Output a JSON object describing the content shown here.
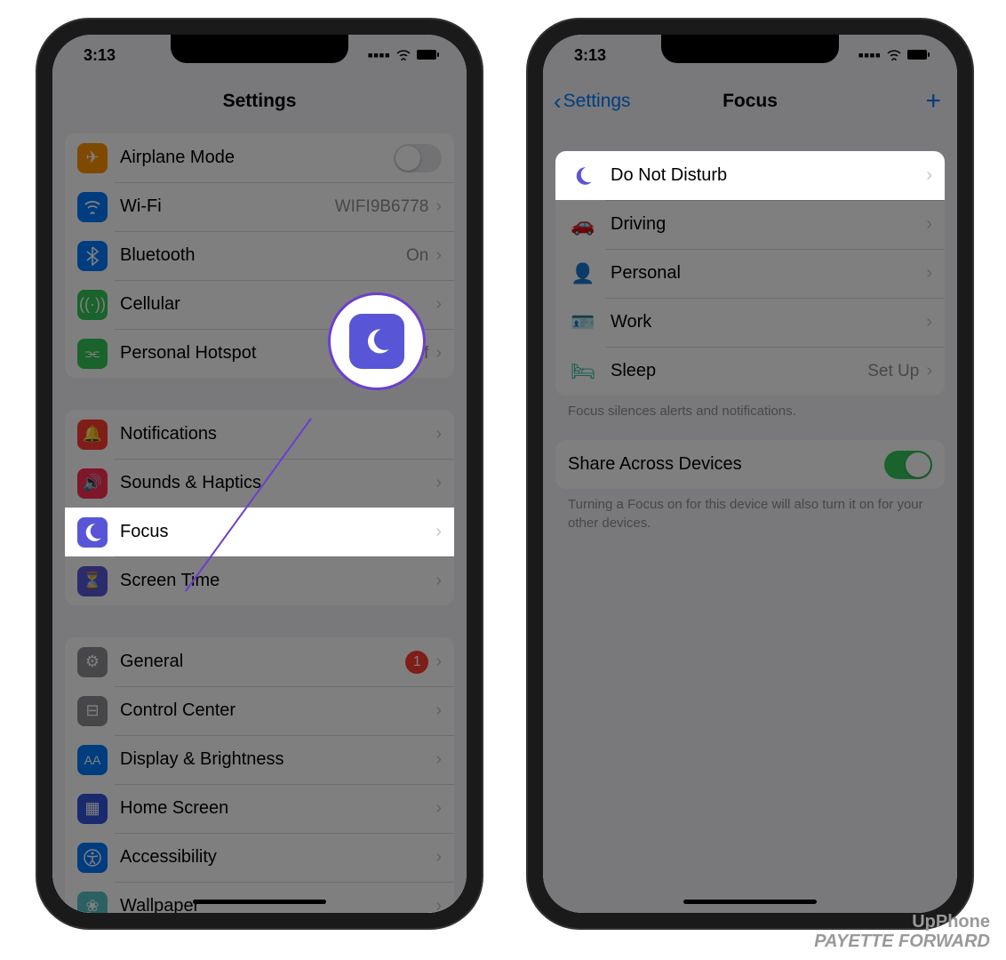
{
  "status": {
    "time": "3:13"
  },
  "left": {
    "title": "Settings",
    "groups": [
      [
        {
          "icon": "airplane-icon",
          "color": "#ff9500",
          "label": "Airplane Mode",
          "toggle": false
        },
        {
          "icon": "wifi-icon",
          "color": "#007aff",
          "label": "Wi-Fi",
          "value": "WIFI9B6778"
        },
        {
          "icon": "bluetooth-icon",
          "color": "#007aff",
          "label": "Bluetooth",
          "value": "On"
        },
        {
          "icon": "cellular-icon",
          "color": "#34c759",
          "label": "Cellular"
        },
        {
          "icon": "hotspot-icon",
          "color": "#34c759",
          "label": "Personal Hotspot",
          "value": "Off"
        }
      ],
      [
        {
          "icon": "notifications-icon",
          "color": "#ff3b30",
          "label": "Notifications"
        },
        {
          "icon": "sounds-icon",
          "color": "#ff2d55",
          "label": "Sounds & Haptics"
        },
        {
          "icon": "focus-icon",
          "color": "#5856d6",
          "label": "Focus",
          "highlight": true
        },
        {
          "icon": "screentime-icon",
          "color": "#5856d6",
          "label": "Screen Time"
        }
      ],
      [
        {
          "icon": "general-icon",
          "color": "#8e8e93",
          "label": "General",
          "badge": "1"
        },
        {
          "icon": "control-center-icon",
          "color": "#8e8e93",
          "label": "Control Center"
        },
        {
          "icon": "display-icon",
          "color": "#007aff",
          "label": "Display & Brightness"
        },
        {
          "icon": "homescreen-icon",
          "color": "#3355dd",
          "label": "Home Screen"
        },
        {
          "icon": "accessibility-icon",
          "color": "#007aff",
          "label": "Accessibility"
        },
        {
          "icon": "wallpaper-icon",
          "color": "#59c2c9",
          "label": "Wallpaper"
        }
      ]
    ]
  },
  "right": {
    "back": "Settings",
    "title": "Focus",
    "focusItems": [
      {
        "icon": "moon-icon",
        "color": "#5856d6",
        "label": "Do Not Disturb",
        "highlight": true
      },
      {
        "icon": "car-icon",
        "color": "#4a5a78",
        "label": "Driving"
      },
      {
        "icon": "person-icon",
        "color": "#9b59b6",
        "label": "Personal"
      },
      {
        "icon": "work-icon",
        "color": "#1abc9c",
        "label": "Work"
      },
      {
        "icon": "sleep-icon",
        "color": "#1abc9c",
        "label": "Sleep",
        "value": "Set Up"
      }
    ],
    "focusHint": "Focus silences alerts and notifications.",
    "share": {
      "label": "Share Across Devices",
      "on": true
    },
    "shareHint": "Turning a Focus on for this device will also turn it on for your other devices."
  },
  "watermark": {
    "line1": "UpPhone",
    "line2": "PAYETTE FORWARD"
  }
}
